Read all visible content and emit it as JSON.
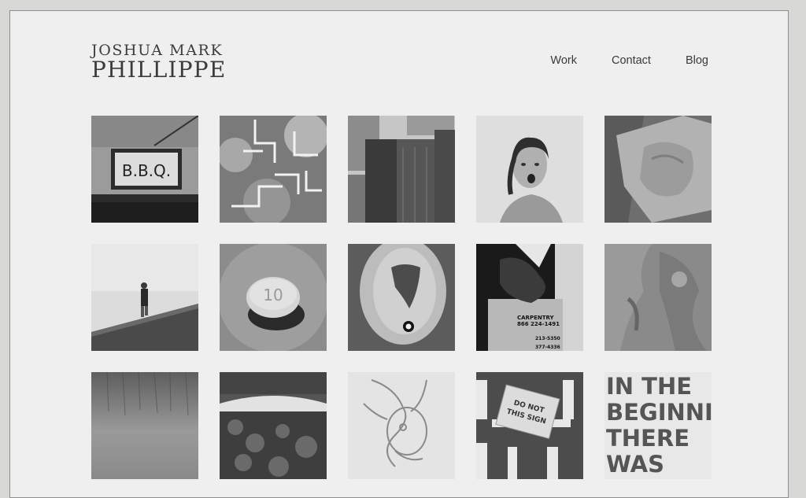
{
  "site": {
    "name_line1": "JOSHUA MARK",
    "name_line2": "PHILLIPPE"
  },
  "nav": {
    "items": [
      {
        "label": "Work"
      },
      {
        "label": "Contact"
      },
      {
        "label": "Blog"
      }
    ]
  },
  "tiles": {
    "bbq_sign": "B.B.Q.",
    "pill_marking": "10",
    "poster_lines": [
      "CARPENTRY",
      "866 224-1491",
      "213-5350",
      "377-4336"
    ],
    "note_text": [
      "DO NOT",
      "THIS SIGN"
    ],
    "graffiti_lines": [
      "IN THE",
      "BEGINNI",
      "THERE",
      "WAS"
    ]
  },
  "colors": {
    "page_bg": "#efefef",
    "outer_bg": "#d8d8d6",
    "text": "#3c3c3c"
  }
}
